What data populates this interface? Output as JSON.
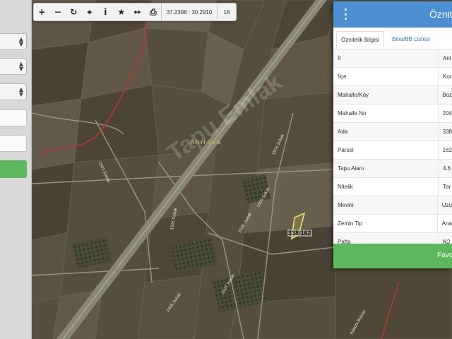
{
  "toolbar": {
    "buttons": [
      {
        "name": "zoom-in",
        "glyph": "+"
      },
      {
        "name": "zoom-out",
        "glyph": "−"
      },
      {
        "name": "refresh",
        "glyph": "↻"
      },
      {
        "name": "locate",
        "glyph": "⌖"
      },
      {
        "name": "info",
        "glyph": "i"
      },
      {
        "name": "favorite",
        "glyph": "★"
      },
      {
        "name": "measure",
        "glyph": "↔"
      },
      {
        "name": "print",
        "glyph": "⎙"
      }
    ],
    "coordinates": "37.2398 : 30.2910",
    "zoom_level": "16"
  },
  "map": {
    "place_label": "Ahırova",
    "parcel_label": "338/162",
    "road_labels": [
      "1503 Sokak",
      "1504 Sokak",
      "1505 Sokak",
      "1506 Sokak",
      "1507 Sokak",
      "1508 Sokak",
      "1509 Sokak",
      "Atatürk Bulvarı"
    ],
    "watermark": "Tapu Emlak"
  },
  "panel": {
    "title": "Öznitelik",
    "tabs": [
      "Öznitelik Bilgisi",
      "Bina/BB Listesi"
    ],
    "rows": [
      {
        "key": "İl",
        "value": "Ant"
      },
      {
        "key": "İlçe",
        "value": "Kor"
      },
      {
        "key": "Mahalle/Köy",
        "value": "Boz"
      },
      {
        "key": "Mahalle No",
        "value": "204"
      },
      {
        "key": "Ada",
        "value": "338"
      },
      {
        "key": "Parsel",
        "value": "162"
      },
      {
        "key": "Tapu Alanı",
        "value": "4.6"
      },
      {
        "key": "Nitelik",
        "value": "Tar"
      },
      {
        "key": "Mevkii",
        "value": "Uzu"
      },
      {
        "key": "Zemin Tip",
        "value": "Ana"
      },
      {
        "key": "Pafta",
        "value": "N2"
      }
    ],
    "footer_label": "Favo"
  },
  "colors": {
    "panel_header": "#4a90d2",
    "footer_green": "#5cb85c",
    "parcel_outline": "#e8e25c",
    "boundary_red": "#c0392b"
  }
}
